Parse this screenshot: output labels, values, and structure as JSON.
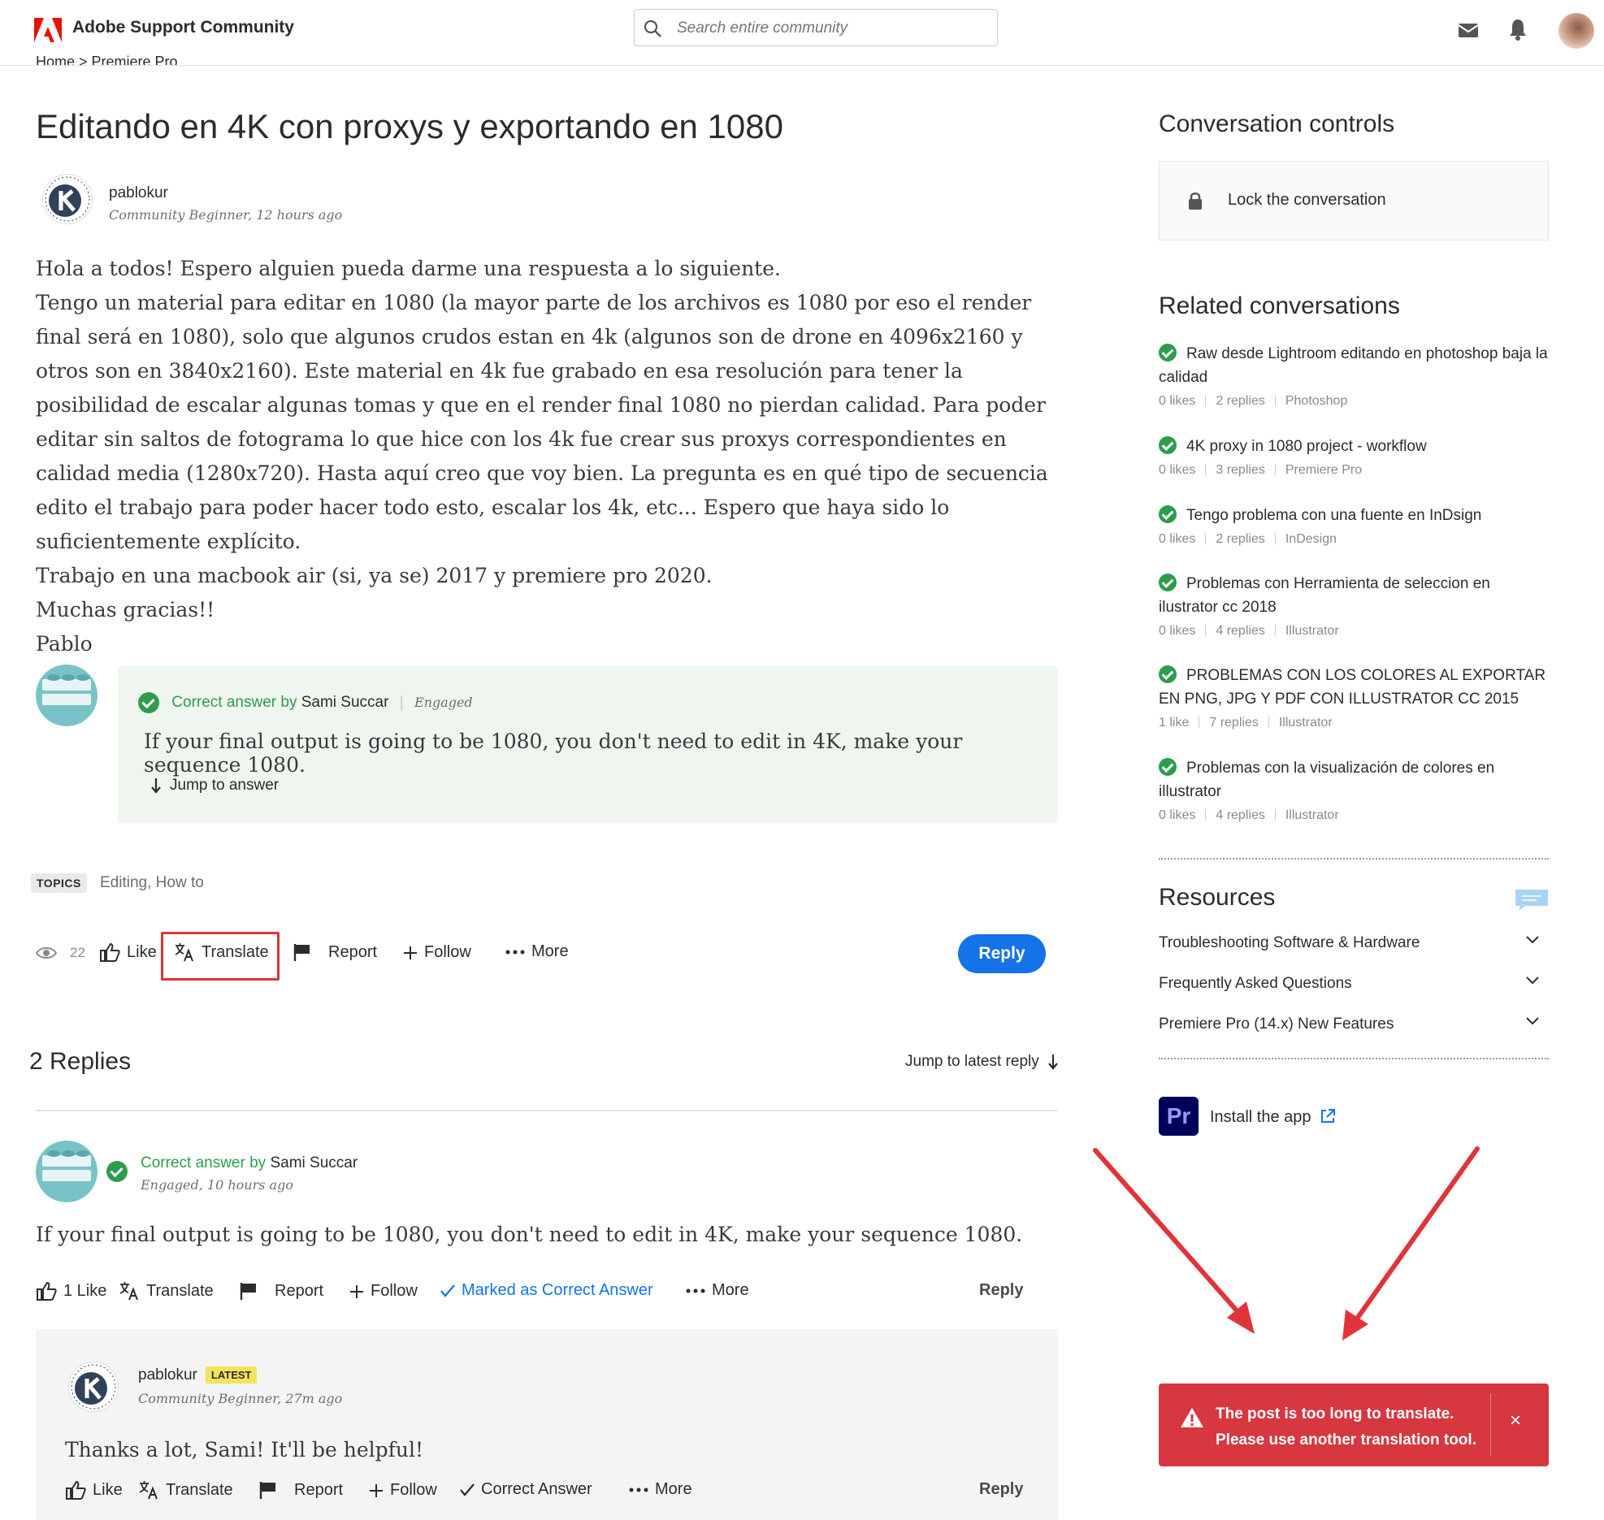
{
  "header": {
    "brand": "Adobe Support Community",
    "search_placeholder": "Search entire community"
  },
  "breadcrumb": "Home  >  Premiere Pro",
  "post": {
    "title": "Editando en 4K con proxys y exportando en 1080",
    "author": "pablokur",
    "rank": "Community Beginner",
    "time": "12 hours ago",
    "body": [
      "Hola a todos! Espero alguien pueda darme una respuesta a lo siguiente.",
      "Tengo un material para editar en 1080 (la mayor parte de los archivos es 1080 por eso el render final será en 1080), solo que algunos crudos estan en 4k (algunos son de drone en 4096x2160 y otros son en 3840x2160). Este material en 4k fue grabado en esa resolución para tener la posibilidad de escalar algunas tomas y que en el render final 1080 no pierdan calidad. Para poder editar sin saltos de fotograma lo que hice con los 4k fue crear sus proxys correspondientes en calidad media (1280x720). Hasta aquí creo que voy bien. La pregunta es en qué tipo de secuencia edito el trabajo para poder hacer todo esto, escalar los 4k, etc... Espero que haya sido lo suficientemente explícito.",
      "Trabajo en una macbook air (si, ya se) 2017 y premiere pro 2020.",
      "Muchas gracias!!",
      "Pablo"
    ],
    "topics_label": "TOPICS",
    "topics": "Editing, How to",
    "views": "22",
    "actions": {
      "like": "Like",
      "translate": "Translate",
      "report": "Report",
      "follow": "Follow",
      "more": "More",
      "reply": "Reply"
    }
  },
  "correct_answer": {
    "prefix": "Correct answer by",
    "author": "Sami Succar",
    "rank": "Engaged",
    "text": "If your final output is going to be 1080, you don't need to edit in 4K, make your sequence 1080.",
    "jump": "Jump to answer"
  },
  "replies": {
    "title": "2 Replies",
    "jump_latest": "Jump to latest reply",
    "reply1": {
      "prefix": "Correct answer by",
      "author": "Sami Succar",
      "rank": "Engaged",
      "time": "10 hours ago",
      "text": "If your final output is going to be 1080, you don't need to edit in 4K, make your sequence 1080.",
      "likes": "1 Like",
      "translate": "Translate",
      "report": "Report",
      "follow": "Follow",
      "marked": "Marked as Correct Answer",
      "more": "More",
      "reply": "Reply"
    },
    "reply2": {
      "author": "pablokur",
      "badge": "LATEST",
      "rank": "Community Beginner",
      "time": "27m ago",
      "text": "Thanks a lot, Sami! It'll be helpful!",
      "like": "Like",
      "translate": "Translate",
      "report": "Report",
      "follow": "Follow",
      "correct": "Correct Answer",
      "more": "More",
      "reply": "Reply"
    }
  },
  "sidebar": {
    "controls_title": "Conversation controls",
    "lock_label": "Lock the conversation",
    "related_title": "Related conversations",
    "related": [
      {
        "title": "Raw desde Lightroom editando en photoshop baja la calidad",
        "likes": "0 likes",
        "replies": "2 replies",
        "product": "Photoshop"
      },
      {
        "title": "4K proxy in 1080 project - workflow",
        "likes": "0 likes",
        "replies": "3 replies",
        "product": "Premiere Pro"
      },
      {
        "title": "Tengo problema con una fuente en InDsign",
        "likes": "0 likes",
        "replies": "2 replies",
        "product": "InDesign"
      },
      {
        "title": "Problemas con Herramienta de seleccion en ilustrator cc 2018",
        "likes": "0 likes",
        "replies": "4 replies",
        "product": "Illustrator"
      },
      {
        "title": "PROBLEMAS CON LOS COLORES AL EXPORTAR EN PNG, JPG Y PDF CON ILLUSTRATOR CC 2015",
        "likes": "1 like",
        "replies": "7 replies",
        "product": "Illustrator"
      },
      {
        "title": "Problemas con la visualización de colores en illustrator",
        "likes": "0 likes",
        "replies": "4 replies",
        "product": "Illustrator"
      }
    ],
    "resources_title": "Resources",
    "resources": [
      "Troubleshooting Software & Hardware",
      "Frequently Asked Questions",
      "Premiere Pro (14.x) New Features"
    ],
    "app_icon_text": "Pr",
    "install_label": "Install the app"
  },
  "toast": {
    "line1": "The post is too long to translate.",
    "line2": "Please use another translation tool.",
    "close": "×"
  },
  "colors": {
    "adobe_red": "#eb1000",
    "accent_blue": "#1473e6",
    "correct_green": "#2d9d4b",
    "answer_bg": "#eef6ef",
    "toast_red": "#d7373f",
    "annotation_red": "#e0343a"
  },
  "icons": [
    "adobe-logo",
    "search-icon",
    "mail-icon",
    "bell-icon",
    "eye-icon",
    "thumbs-up-icon",
    "translate-icon",
    "flag-icon",
    "plus-icon",
    "more-icon",
    "arrow-down-icon",
    "lock-icon",
    "chevron-down-icon",
    "chat-icon",
    "external-link-icon",
    "warning-icon",
    "close-icon",
    "check-icon"
  ]
}
